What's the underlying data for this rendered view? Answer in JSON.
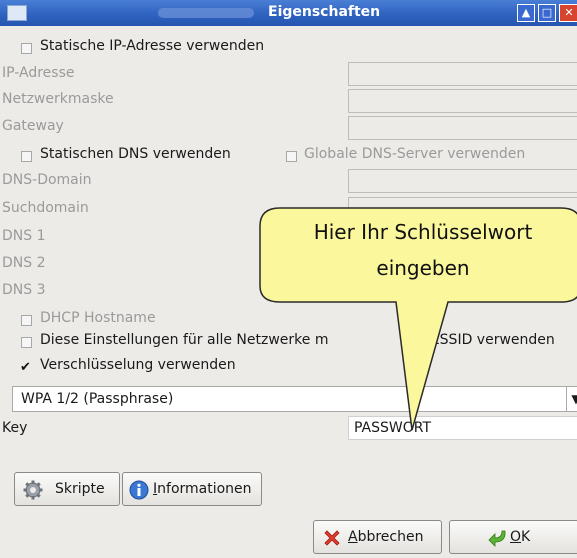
{
  "window": {
    "title": "Eigenschaften"
  },
  "form": {
    "static_ip_label": "Statische IP-Adresse verwenden",
    "ip_label": "IP-Adresse",
    "netmask_label": "Netzwerkmaske",
    "gateway_label": "Gateway",
    "static_dns_label": "Statischen DNS verwenden",
    "global_dns_label": "Globale DNS-Server verwenden",
    "dns_domain_label": "DNS-Domain",
    "search_domain_label": "Suchdomain",
    "dns1_label": "DNS 1",
    "dns2_label": "DNS 2",
    "dns3_label": "DNS 3",
    "dhcp_hostname_label": "DHCP Hostname",
    "all_networks_label_start": "Diese Einstellungen für alle Netzwerke m",
    "all_networks_label_end": "er ESSID verwenden",
    "encryption_label": "Verschlüsselung verwenden",
    "encryption_checked": true,
    "encryption_type": "WPA 1/2 (Passphrase)",
    "key_label": "Key",
    "key_value": "PASSWORT"
  },
  "buttons": {
    "scripts": "Skripte",
    "info_mnemonic": "I",
    "info_rest": "nformationen",
    "cancel_mnemonic": "A",
    "cancel_rest": "bbrechen",
    "ok_mnemonic": "O",
    "ok_rest": "K"
  },
  "callout": {
    "line1": "Hier Ihr Schlüsselwort",
    "line2": "eingeben"
  },
  "icons": {
    "window": "window-icon",
    "scripts": "gear-icon",
    "info": "info-icon",
    "cancel": "cancel-x-icon",
    "ok": "ok-arrow-icon"
  },
  "colors": {
    "titlebar": "#2f63c0",
    "callout_fill": "#fbf79c",
    "background": "#ecebe8"
  }
}
